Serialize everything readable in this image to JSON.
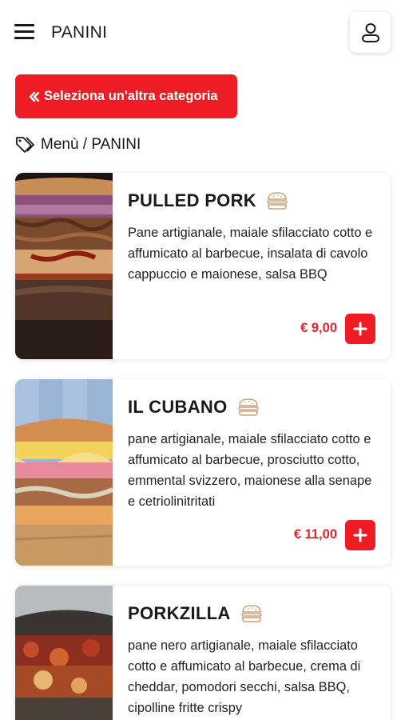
{
  "header": {
    "title": "PANINI"
  },
  "category_button": {
    "label": "Seleziona un'altra categoria"
  },
  "breadcrumb": {
    "text": "Menù / PANINI"
  },
  "products": [
    {
      "name": "PULLED PORK",
      "description": "Pane artigianale, maiale sfilacciato cotto e affumicato al barbecue, insalata di cavolo cappuccio e maionese, salsa BBQ",
      "price": "€ 9,00"
    },
    {
      "name": "IL CUBANO",
      "description": "pane artigianale, maiale sfilacciato cotto e affumicato al barbecue, prosciutto cotto, emmental svizzero, maionese alla senape e cetriolinitritati",
      "price": "€ 11,00"
    },
    {
      "name": "PORKZILLA",
      "description": "pane nero artigianale, maiale sfilacciato cotto e affumicato al barbecue, crema di cheddar, pomodori secchi, salsa BBQ, cipolline fritte crispy",
      "price": ""
    }
  ],
  "colors": {
    "accent": "#ee1c25",
    "price": "#e0222a",
    "text": "#1a1a1a"
  },
  "icons": {
    "menu": "hamburger-menu-icon",
    "user": "user-icon",
    "back": "double-chevron-left-icon",
    "tag": "tag-icon",
    "category": "burger-icon",
    "add": "plus-icon"
  }
}
